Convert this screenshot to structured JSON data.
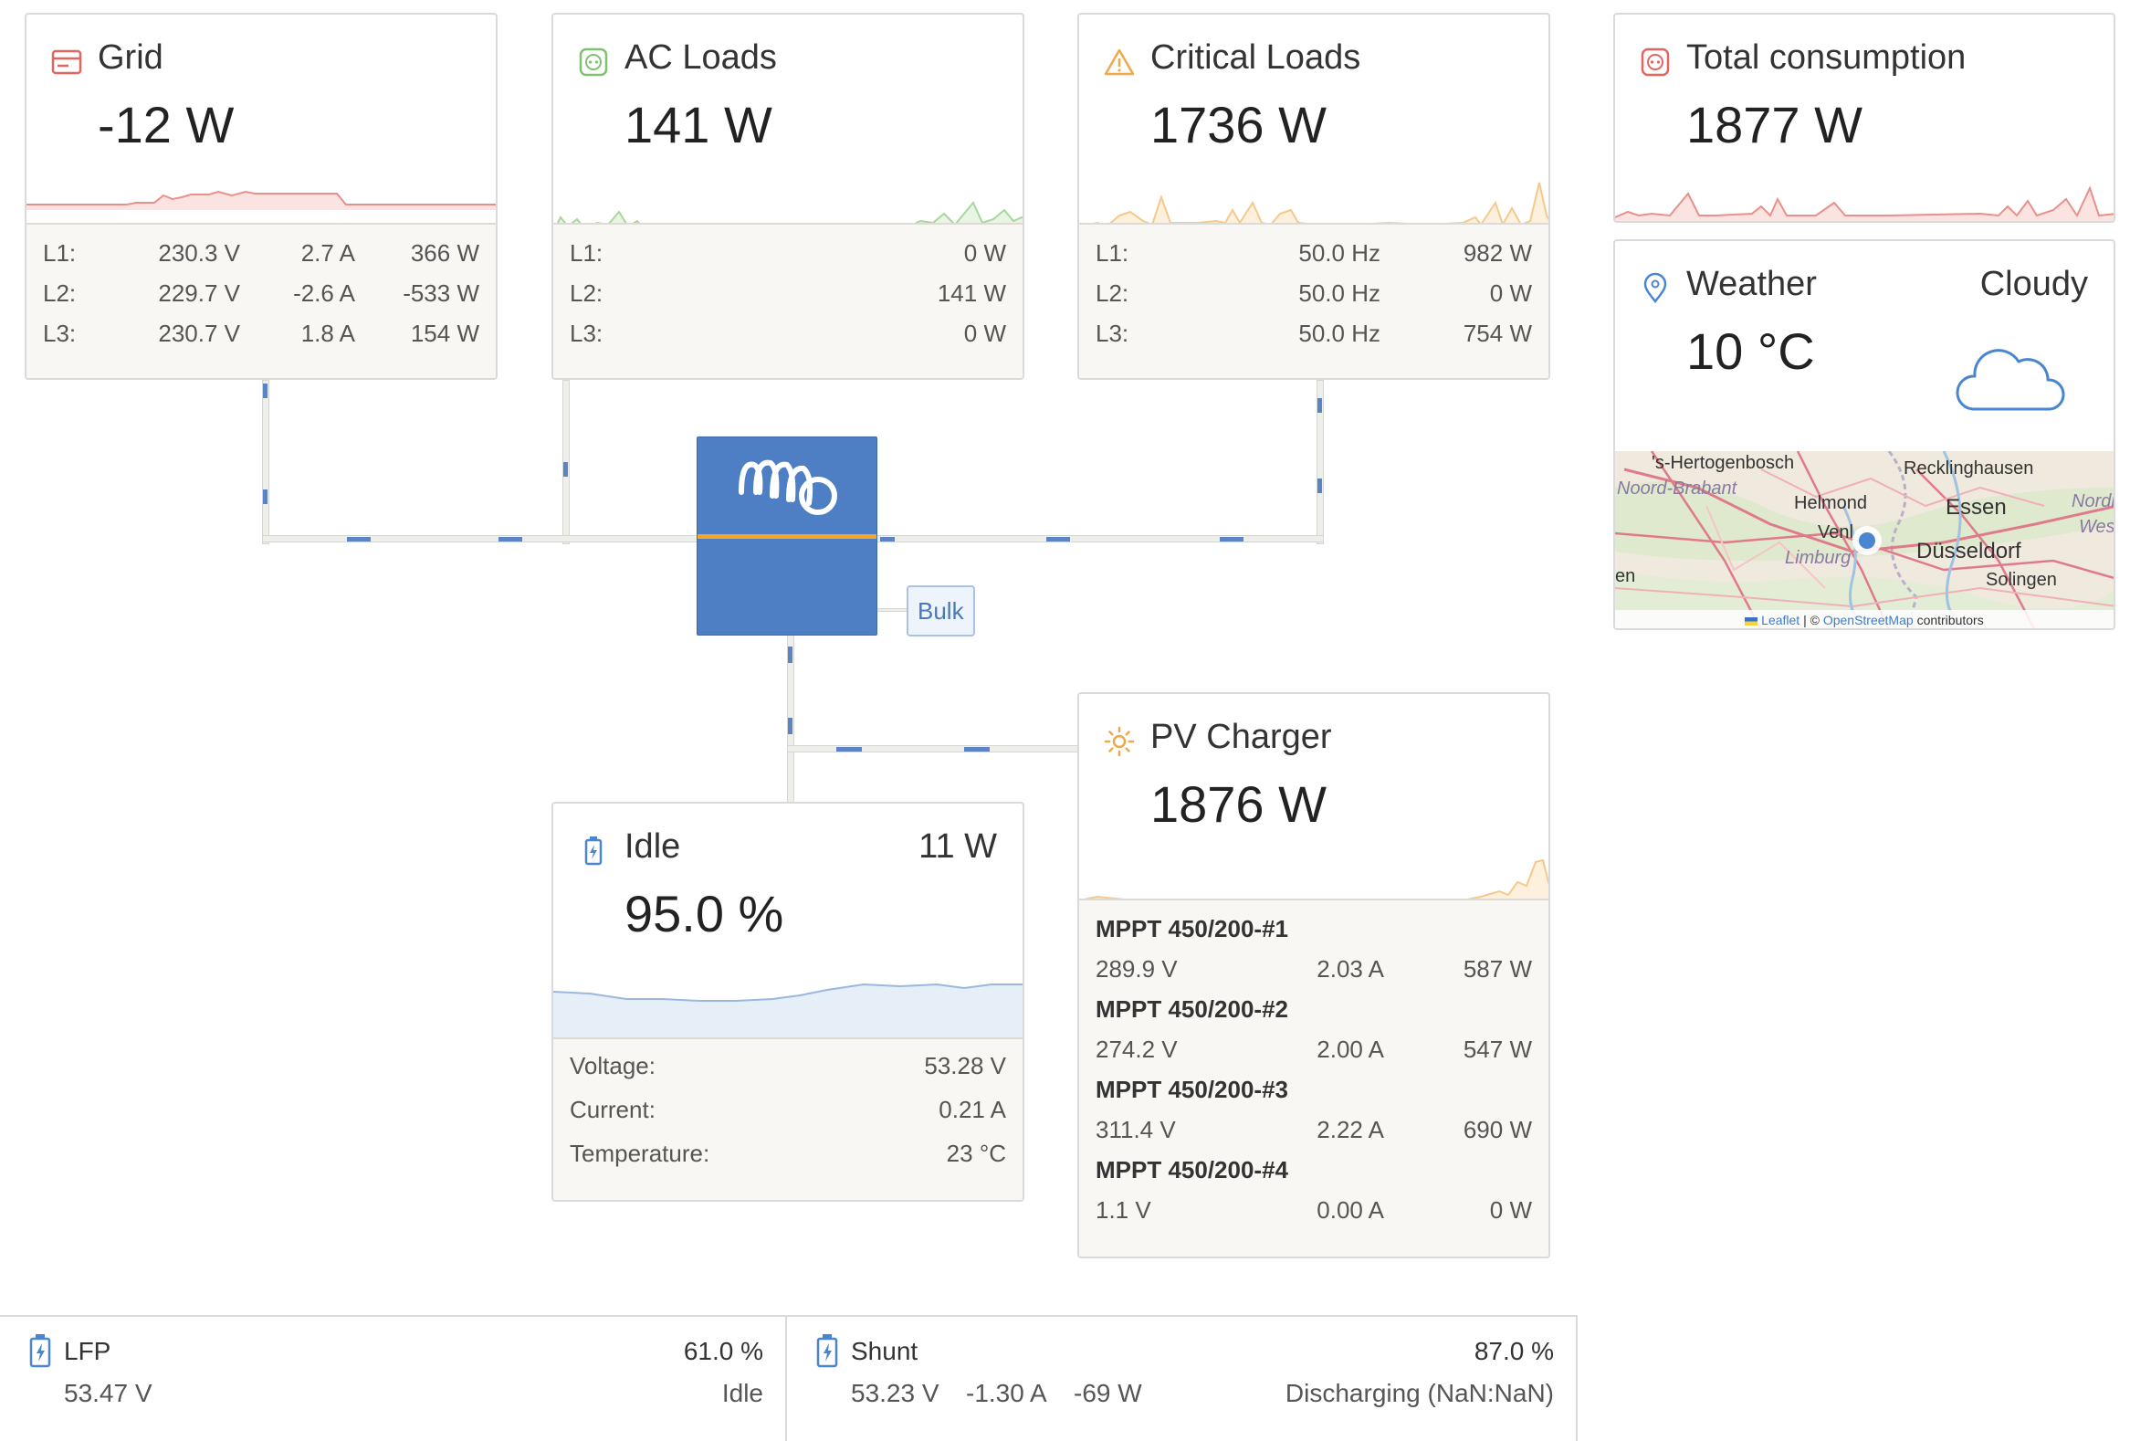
{
  "grid": {
    "title": "Grid",
    "value": "-12 W",
    "rows": [
      {
        "label": "L1:",
        "voltage": "230.3 V",
        "current": "2.7 A",
        "power": "366 W"
      },
      {
        "label": "L2:",
        "voltage": "229.7 V",
        "current": "-2.6 A",
        "power": "-533 W"
      },
      {
        "label": "L3:",
        "voltage": "230.7 V",
        "current": "1.8 A",
        "power": "154 W"
      }
    ],
    "color": "#e0665f"
  },
  "ac_loads": {
    "title": "AC Loads",
    "value": "141 W",
    "rows": [
      {
        "label": "L1:",
        "power": "0 W"
      },
      {
        "label": "L2:",
        "power": "141 W"
      },
      {
        "label": "L3:",
        "power": "0 W"
      }
    ],
    "color": "#7dc36e"
  },
  "critical_loads": {
    "title": "Critical Loads",
    "value": "1736 W",
    "rows": [
      {
        "label": "L1:",
        "freq": "50.0 Hz",
        "power": "982 W"
      },
      {
        "label": "L2:",
        "freq": "50.0 Hz",
        "power": "0 W"
      },
      {
        "label": "L3:",
        "freq": "50.0 Hz",
        "power": "754 W"
      }
    ],
    "color": "#f0a848"
  },
  "total": {
    "title": "Total consumption",
    "value": "1877 W",
    "color": "#e0665f"
  },
  "weather": {
    "title": "Weather",
    "condition": "Cloudy",
    "temperature": "10 °C",
    "map": {
      "labels": [
        "'s-Hertogenbosch",
        "Recklinghausen",
        "Noord-Brabant",
        "Helmond",
        "Essen",
        "Nordrl",
        "Westfa",
        "Venl",
        "Limburg",
        "Düsseldorf",
        "Solingen",
        "en"
      ],
      "attribution_leaflet": "Leaflet",
      "attribution_sep": "| ©",
      "attribution_osm": "OpenStreetMap",
      "attribution_tail": "contributors"
    }
  },
  "inverter": {
    "state": "Bulk"
  },
  "battery": {
    "state": "Idle",
    "power": "11 W",
    "soc": "95.0 %",
    "rows": [
      {
        "label": "Voltage:",
        "value": "53.28 V"
      },
      {
        "label": "Current:",
        "value": "0.21 A"
      },
      {
        "label": "Temperature:",
        "value": "23 °C"
      }
    ]
  },
  "pv": {
    "title": "PV Charger",
    "value": "1876 W",
    "chargers": [
      {
        "name": "MPPT 450/200-#1",
        "voltage": "289.9 V",
        "current": "2.03 A",
        "power": "587 W"
      },
      {
        "name": "MPPT 450/200-#2",
        "voltage": "274.2 V",
        "current": "2.00 A",
        "power": "547 W"
      },
      {
        "name": "MPPT 450/200-#3",
        "voltage": "311.4 V",
        "current": "2.22 A",
        "power": "690 W"
      },
      {
        "name": "MPPT 450/200-#4",
        "voltage": "1.1 V",
        "current": "0.00 A",
        "power": "0 W"
      }
    ],
    "color": "#f0a848"
  },
  "bottom": {
    "lfp": {
      "name": "LFP",
      "soc": "61.0 %",
      "voltage": "53.47 V",
      "state": "Idle"
    },
    "shunt": {
      "name": "Shunt",
      "soc": "87.0 %",
      "voltage": "53.23 V",
      "current": "-1.30 A",
      "power": "-69 W",
      "state": "Discharging (NaN:NaN)"
    }
  }
}
